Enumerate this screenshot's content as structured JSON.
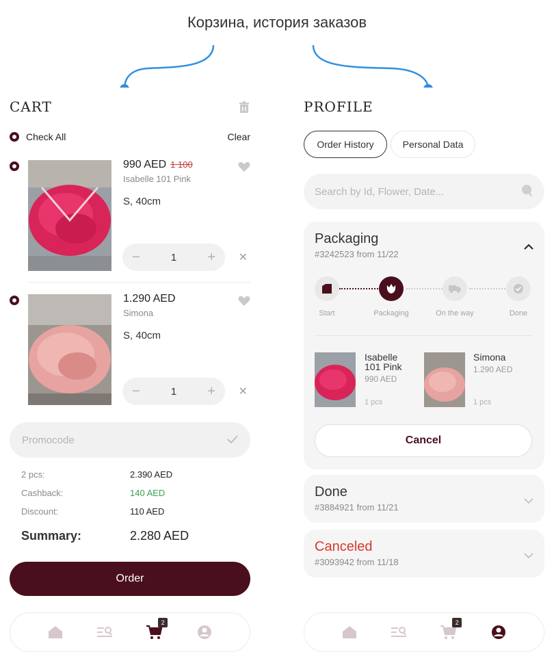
{
  "caption": "Корзина, история заказов",
  "colors": {
    "accent": "#4a0f1c",
    "muted": "#f3f3f3",
    "cashback": "#3aa150",
    "danger": "#d63a2f"
  },
  "cart": {
    "logo": "CART",
    "check_all": "Check All",
    "clear": "Clear",
    "items": [
      {
        "price": "990 AED",
        "old_price": "1 100",
        "name": "Isabelle 101 Pink",
        "size": "S, 40cm",
        "qty": "1"
      },
      {
        "price": "1.290 AED",
        "old_price": "",
        "name": "Simona",
        "size": "S, 40cm",
        "qty": "1"
      }
    ],
    "stepper": {
      "minus": "−",
      "plus": "+"
    },
    "remove": "✕",
    "promo_placeholder": "Promocode",
    "totals": [
      {
        "label": "2 pcs:",
        "value": "2.390 AED"
      },
      {
        "label": "Cashback:",
        "value": "140 AED"
      },
      {
        "label": "Discount:",
        "value": "110 AED"
      }
    ],
    "summary": {
      "label": "Summary:",
      "value": "2.280 AED"
    },
    "order_button": "Order"
  },
  "profile": {
    "logo": "PROFILE",
    "tabs": [
      "Order History",
      "Personal Data"
    ],
    "search_placeholder": "Search by Id, Flower, Date...",
    "orders": [
      {
        "status": "Packaging",
        "meta": "#3242523 from 11/22",
        "steps": [
          "Start",
          "Packaging",
          "On the way",
          "Done"
        ],
        "current_step": 1,
        "items": [
          {
            "name": "Isabelle 101 Pink",
            "price": "990 AED",
            "qty": "1 pcs"
          },
          {
            "name": "Simona",
            "price": "1.290 AED",
            "qty": "1 pcs"
          }
        ],
        "cancel_button": "Cancel"
      },
      {
        "status": "Done",
        "meta": "#3884921 from 11/21"
      },
      {
        "status": "Canceled",
        "meta": "#3093942 from 11/18"
      }
    ]
  },
  "tabbar": {
    "icons": [
      "home-icon",
      "catalog-search-icon",
      "cart-icon",
      "profile-icon"
    ],
    "cart_badge": "2"
  }
}
